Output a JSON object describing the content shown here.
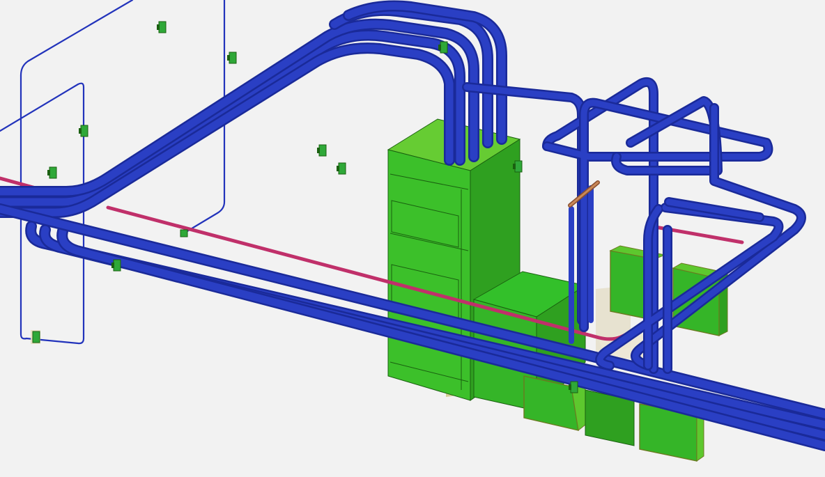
{
  "viewport": {
    "background_color": "#f2f2f2",
    "content": "3d-model-view"
  },
  "colors": {
    "conduit": "#2a3fc4",
    "conduit_highlight": "#4a5fe0",
    "conduit_dark": "#1a2a99",
    "thin_wire": "#2233bb",
    "pink_conduit": "#c0306a",
    "copper_bar": "#b8764a",
    "cabinet_face": "#3cc02a",
    "cabinet_side": "#2fa020",
    "cabinet_top": "#66cc33",
    "cabinet_edge": "#1a6010",
    "box_face": "#35b528",
    "box_top": "#5dc82e",
    "box_edge": "#6b7a20",
    "clip": "#2fa838",
    "ghost_box": "#e6e0cc"
  },
  "icons": [
    "junction-box-icon",
    "conduit-clip-icon"
  ]
}
